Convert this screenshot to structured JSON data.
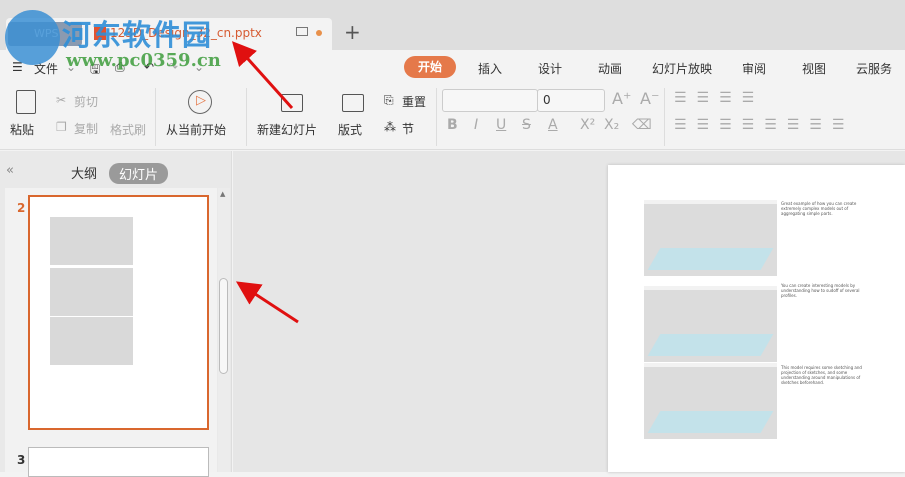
{
  "titlebar": {
    "file_name": "123D_Design_32_cn.pptx",
    "app_badge": "WPS",
    "new_tab": "+"
  },
  "watermark": {
    "name": "河东软件园",
    "url": "www.pc0359.cn"
  },
  "quickbar": {
    "file_menu": "文件"
  },
  "menu_tabs": [
    "开始",
    "插入",
    "设计",
    "动画",
    "幻灯片放映",
    "审阅",
    "视图",
    "云服务"
  ],
  "active_tab": "开始",
  "ribbon": {
    "paste": "粘贴",
    "cut": "剪切",
    "copy": "复制",
    "format_painter": "格式刷",
    "from_current": "从当前开始",
    "new_slide": "新建幻灯片",
    "layout": "版式",
    "reset": "重置",
    "section": "节",
    "font_name": "",
    "font_size": "0"
  },
  "left_panel": {
    "tab_outline": "大纲",
    "tab_slides": "幻灯片",
    "slide_numbers": [
      "2",
      "3"
    ]
  },
  "slide": {
    "captions": [
      "Great example of how you can create extremely complex models out of aggregating simple parts.",
      "You can create interesting models by understanding how to sudoff of several profiles.",
      "This model requires some sketching and projection of sketches, and some understanding around manipulations of sketches beforehand."
    ]
  },
  "colors": {
    "accent": "#e5794a",
    "selected_border": "#d9672e",
    "arrow": "#e01010"
  }
}
